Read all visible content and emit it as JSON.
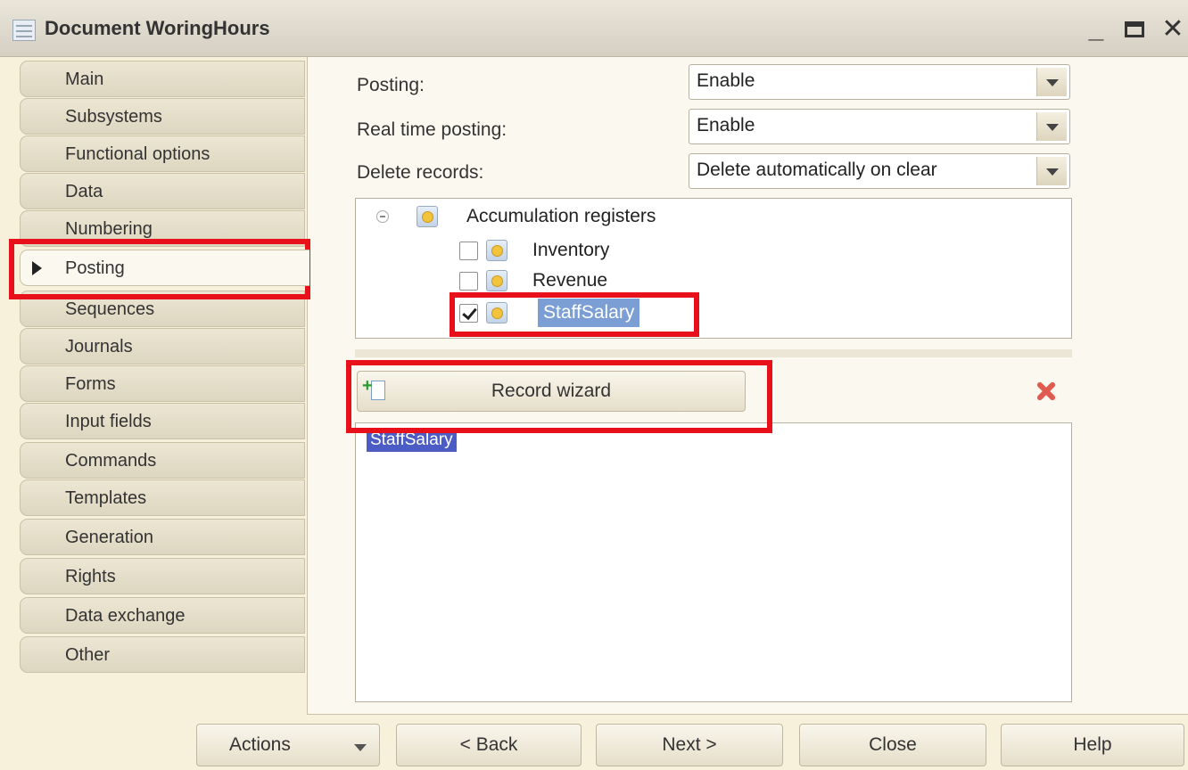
{
  "window": {
    "title": "Document WoringHours"
  },
  "title_controls": {
    "minimize": "_",
    "close": "✕"
  },
  "tabs": [
    {
      "label": "Main"
    },
    {
      "label": "Subsystems"
    },
    {
      "label": "Functional options"
    },
    {
      "label": "Data"
    },
    {
      "label": "Numbering"
    },
    {
      "label": "Posting",
      "active": true
    },
    {
      "label": "Sequences"
    },
    {
      "label": "Journals"
    },
    {
      "label": "Forms"
    },
    {
      "label": "Input fields"
    },
    {
      "label": "Commands"
    },
    {
      "label": "Templates"
    },
    {
      "label": "Generation"
    },
    {
      "label": "Rights"
    },
    {
      "label": "Data exchange"
    },
    {
      "label": "Other"
    }
  ],
  "fields": {
    "posting": {
      "label": "Posting:",
      "value": "Enable"
    },
    "real_time_posting": {
      "label": "Real time posting:",
      "value": "Enable"
    },
    "delete_records": {
      "label": "Delete records:",
      "value": "Delete automatically on clear"
    }
  },
  "tree": {
    "root": {
      "label": "Accumulation registers"
    },
    "items": [
      {
        "label": "Inventory",
        "checked": false
      },
      {
        "label": "Revenue",
        "checked": false
      },
      {
        "label": "StaffSalary",
        "checked": true
      }
    ]
  },
  "record_wizard": {
    "label": "Record wizard"
  },
  "editor": {
    "text": "StaffSalary"
  },
  "buttons": {
    "actions": "Actions",
    "back": "< Back",
    "next": "Next >",
    "close": "Close",
    "help": "Help"
  },
  "colors": {
    "highlight": "#e8101a",
    "selection": "#7b9fd4",
    "window_bg": "#f7f1dc"
  }
}
